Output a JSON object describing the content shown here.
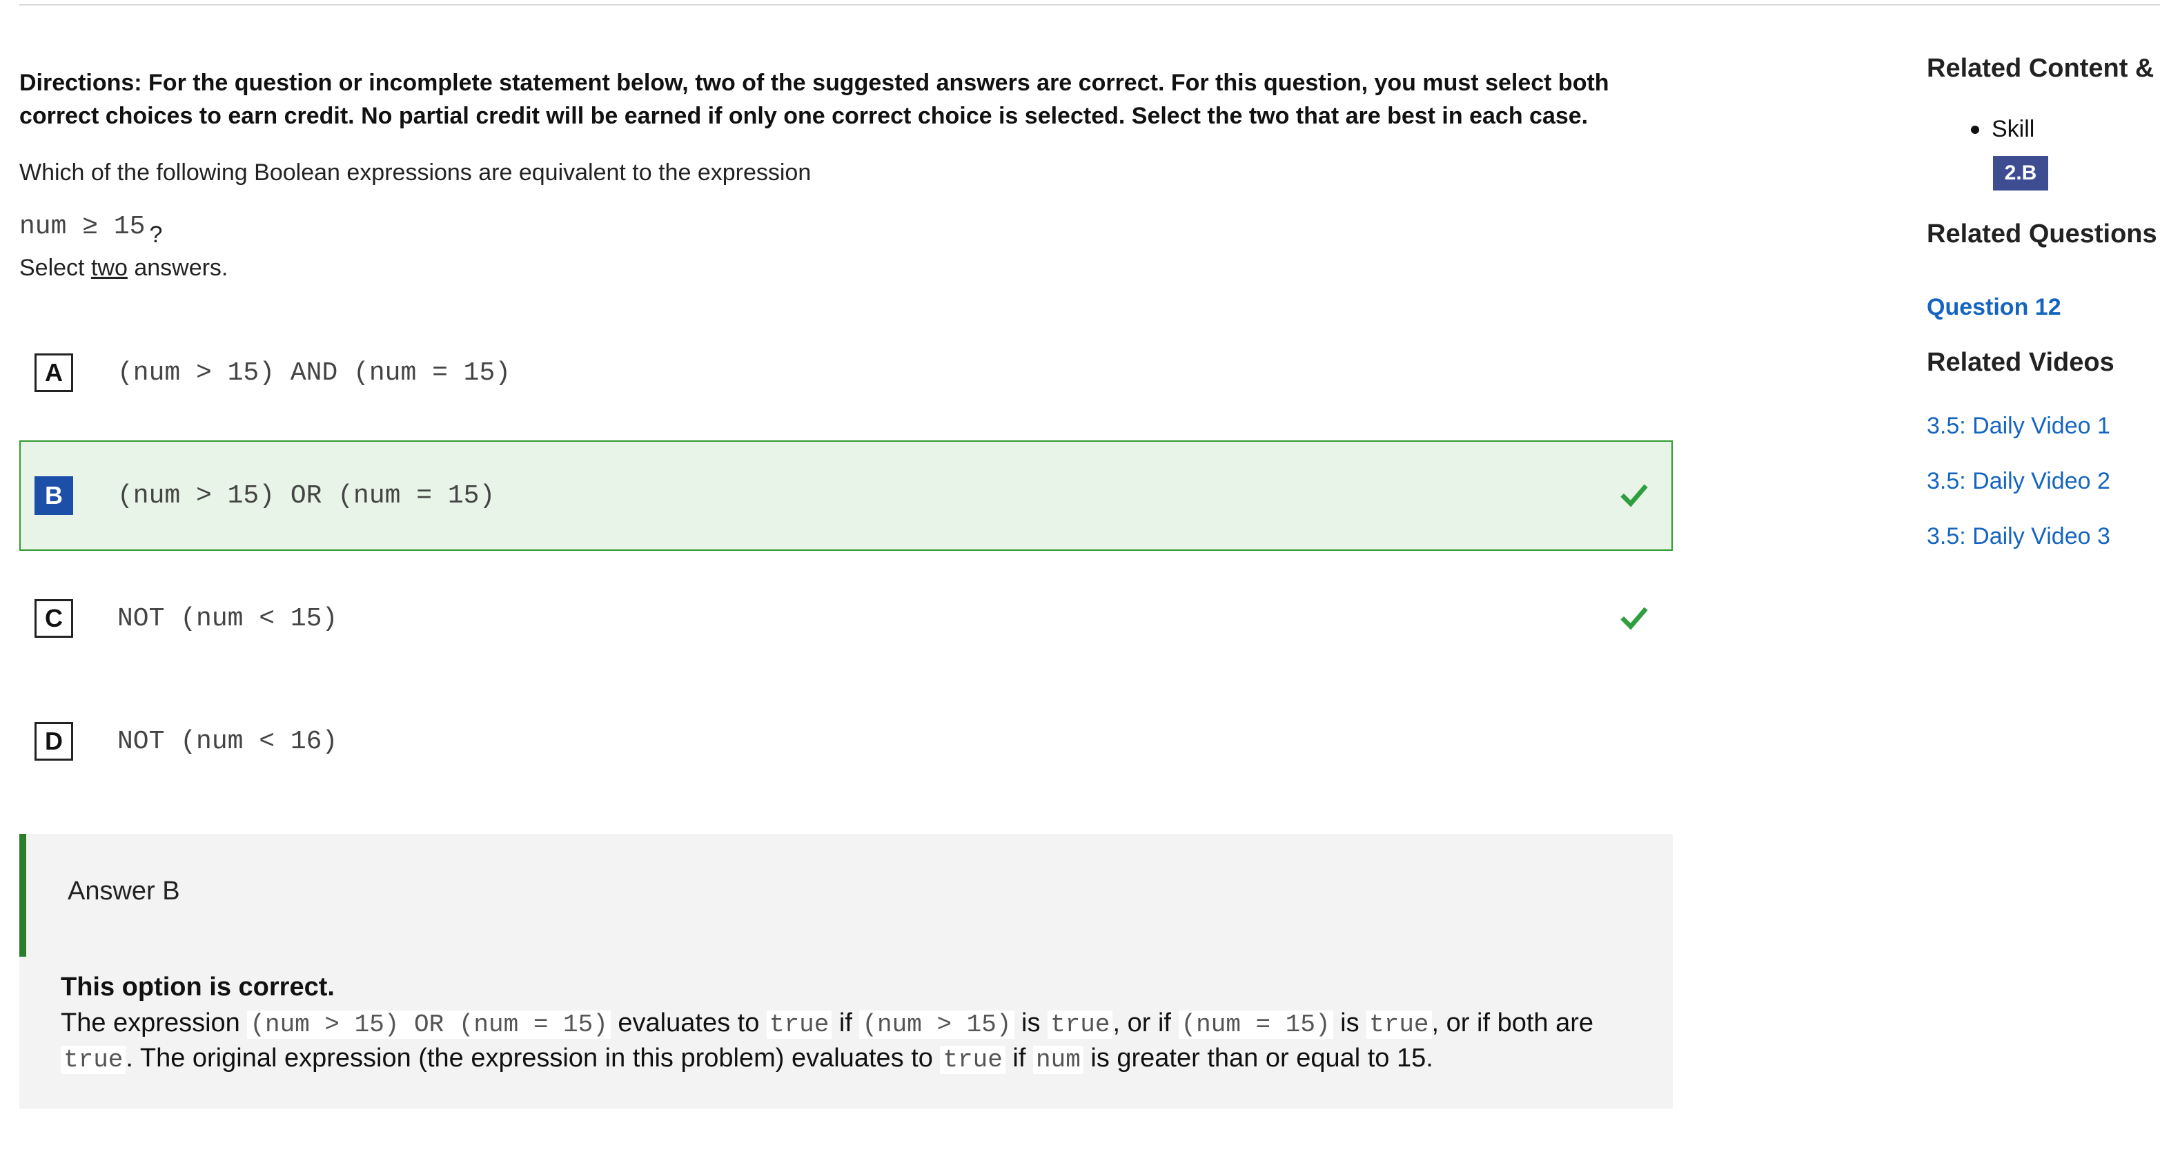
{
  "question": {
    "directions": "Directions: For the question or incomplete statement below, two of the suggested answers are correct. For this question, you must select both correct choices to earn credit. No partial credit will be earned if only one correct choice is selected. Select the two that are best in each case.",
    "stem": "Which of the following Boolean expressions are equivalent to the expression",
    "expression": "num ≥ 15",
    "expression_suffix": "?",
    "select_prefix": "Select ",
    "select_count": "two",
    "select_suffix": " answers."
  },
  "choices": [
    {
      "letter": "A",
      "code": "(num > 15) AND (num = 15)",
      "selected": false,
      "correct": false
    },
    {
      "letter": "B",
      "code": "(num > 15) OR (num = 15)",
      "selected": true,
      "correct": true
    },
    {
      "letter": "C",
      "code": "NOT (num < 15)",
      "selected": false,
      "correct": true
    },
    {
      "letter": "D",
      "code": "NOT (num < 16)",
      "selected": false,
      "correct": false
    }
  ],
  "explanation": {
    "answer_label": "Answer B",
    "heading": "This option is correct.",
    "t1": "The expression ",
    "c1": "(num > 15) OR (num = 15)",
    "t2": " evaluates to ",
    "c2": "true",
    "t3": " if ",
    "c3": "(num > 15)",
    "t4": " is ",
    "c4": "true",
    "t5": ", or if ",
    "c5": "(num = 15)",
    "t6": " is ",
    "c6": "true",
    "t7": ", or if both are ",
    "c7": "true",
    "t8": ". The original expression (the expression in this problem) evaluates to ",
    "c8": "true",
    "t9": " if ",
    "c9": "num",
    "t10": " is greater than or equal to 15."
  },
  "sidebar": {
    "related_content_heading": "Related Content & S",
    "skill_label": "Skill",
    "skill_badge": "2.B",
    "related_questions_heading": "Related Questions c",
    "question_link": "Question 12",
    "related_videos_heading": "Related Videos",
    "videos": [
      "3.5: Daily Video 1",
      "3.5: Daily Video 2",
      "3.5: Daily Video 3"
    ]
  },
  "colors": {
    "selected_bg": "#e8f4e8",
    "selected_border": "#2f9a2f",
    "check_green": "#2e9e3e",
    "badge_blue": "#3e4d92",
    "link_blue": "#1565c0",
    "letter_selected": "#1b4fa8"
  },
  "icons": {
    "correct": "check-icon"
  }
}
